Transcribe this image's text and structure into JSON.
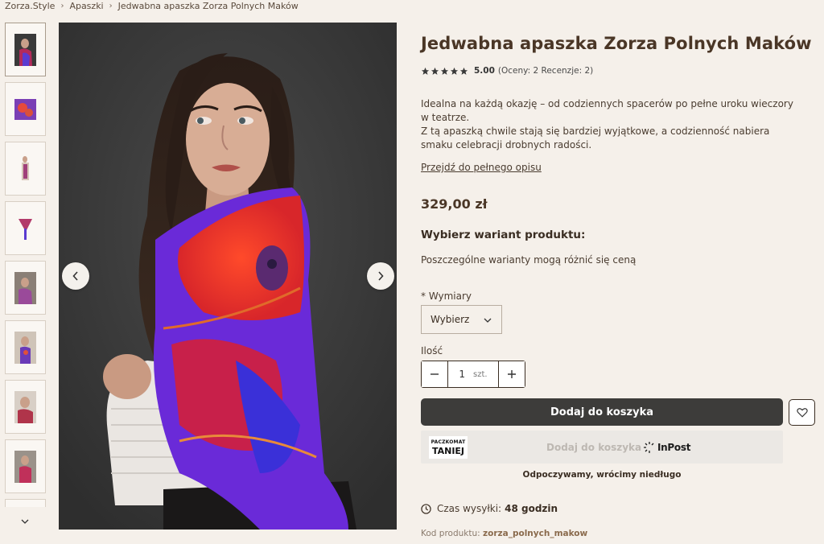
{
  "breadcrumb": {
    "items": [
      "Zorza.Style",
      "Apaszki",
      "Jedwabna apaszka Zorza Polnych Maków"
    ]
  },
  "gallery": {
    "thumbnail_count": 8,
    "active_index": 0
  },
  "product": {
    "title": "Jedwabna apaszka Zorza Polnych Maków",
    "rating": {
      "score": "5.00",
      "details": "(Oceny: 2 Recenzje: 2)",
      "stars": 5
    },
    "description": [
      "Idealna na każdą okazję – od codziennych spacerów po pełne uroku wieczory w teatrze.",
      "Z tą apaszką chwile stają się bardziej wyjątkowe, a codzienność nabiera smaku celebracji drobnych radości."
    ],
    "full_description_link": "Przejdź do pełnego opisu",
    "price": "329,00 zł"
  },
  "variant": {
    "heading": "Wybierz wariant produktu:",
    "note": "Poszczególne warianty mogą różnić się ceną",
    "required_mark": "*",
    "dimension_label": "Wymiary",
    "select_value": "Wybierz"
  },
  "quantity": {
    "label": "Ilość",
    "value": "1",
    "unit": "szt."
  },
  "actions": {
    "add_to_cart": "Dodaj do koszyka"
  },
  "inpost": {
    "logo_line1": "PACZKOMAT",
    "logo_line2": "TANIEJ",
    "label": "Dodaj do koszyka",
    "brand": "InPost",
    "status": "Odpoczywamy, wrócimy niedługo"
  },
  "shipping": {
    "label": "Czas wysyłki:",
    "value": "48 godzin"
  },
  "product_code": {
    "label": "Kod produktu:",
    "value": "zorza_polnych_makow"
  },
  "colors": {
    "background": "#f5f0ea",
    "title": "#4a3626",
    "add_to_cart_bg": "#3d3c3a",
    "inpost_bg": "#ebe8e4"
  }
}
